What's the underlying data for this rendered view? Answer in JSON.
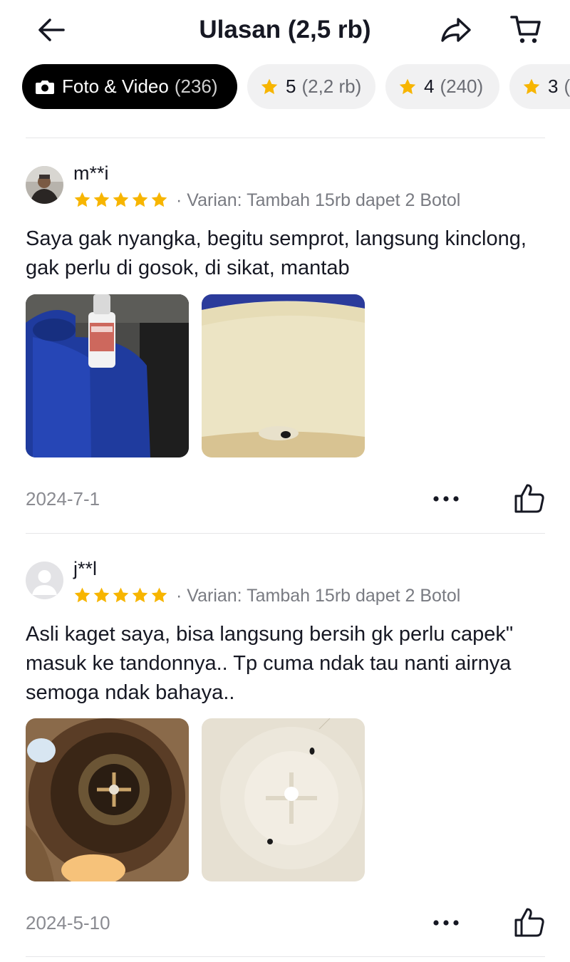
{
  "header": {
    "title": "Ulasan (2,5 rb)",
    "back_icon": "back-arrow-icon",
    "share_icon": "share-arrow-icon",
    "cart_icon": "cart-icon"
  },
  "filters": [
    {
      "label": "Foto & Video",
      "count": "(236)",
      "icon": "camera-icon",
      "active": true
    },
    {
      "label": "5",
      "count": "(2,2 rb)",
      "icon": "star-icon",
      "active": false
    },
    {
      "label": "4",
      "count": "(240)",
      "icon": "star-icon",
      "active": false
    },
    {
      "label": "3",
      "count": "(",
      "icon": "star-icon",
      "active": false
    }
  ],
  "colors": {
    "star": "#f7b500",
    "active_chip_bg": "#000000",
    "chip_bg": "#f1f1f2",
    "muted_text": "#797b82"
  },
  "reviews": [
    {
      "user": "m**i",
      "rating": 5,
      "variant": "· Varian: Tambah 15rb dapet 2 Botol",
      "text": "Saya gak nyangka, begitu semprot, langsung kinclong, gak perlu di gosok, di sikat, mantab",
      "date": "2024-7-1",
      "photo_count": 2
    },
    {
      "user": "j**l",
      "rating": 5,
      "variant": "· Varian: Tambah 15rb dapet 2 Botol",
      "text": "Asli kaget saya, bisa langsung bersih gk perlu capek\" masuk ke tandonnya.. Tp cuma ndak tau nanti airnya semoga ndak bahaya..",
      "date": "2024-5-10",
      "photo_count": 2
    }
  ]
}
